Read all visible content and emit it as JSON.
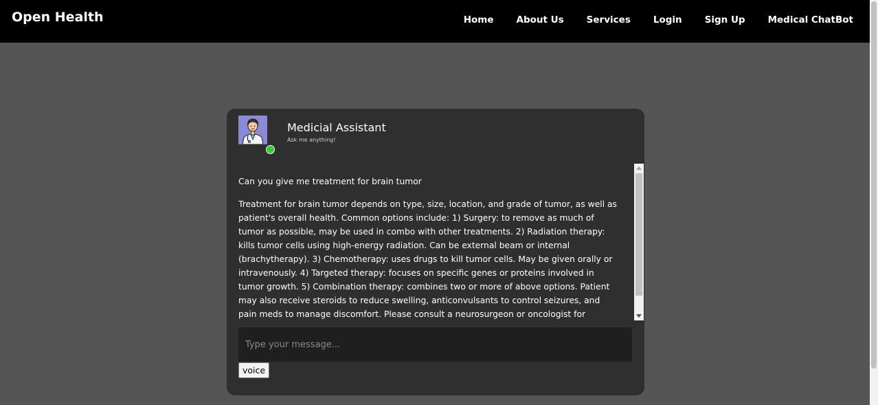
{
  "navbar": {
    "brand": "Open Health",
    "links": [
      {
        "label": "Home"
      },
      {
        "label": "About Us"
      },
      {
        "label": "Services"
      },
      {
        "label": "Login"
      },
      {
        "label": "Sign Up"
      },
      {
        "label": "Medical ChatBot"
      }
    ]
  },
  "chat": {
    "title": "Medicial Assistant",
    "subtitle": "Ask me anything!",
    "status_color": "#3ec43e",
    "messages": [
      {
        "role": "user",
        "text": "Can you give me treatment for brain tumor"
      },
      {
        "role": "assistant",
        "text": "Treatment for brain tumor depends on type, size, location, and grade of tumor, as well as patient's overall health. Common options include: 1) Surgery: to remove as much of tumor as possible, may be used in combo with other treatments. 2) Radiation therapy: kills tumor cells using high-energy radiation. Can be external beam or internal (brachytherapy). 3) Chemotherapy: uses drugs to kill tumor cells. May be given orally or intravenously. 4) Targeted therapy: focuses on specific genes or proteins involved in tumor growth. 5) Combination therapy: combines two or more of above options. Patient may also receive steroids to reduce swelling, anticonvulsants to control seizures, and pain meds to manage discomfort. Please consult a neurosurgeon or oncologist for personalized treatment plan."
      }
    ],
    "input": {
      "placeholder": "Type your message...",
      "value": ""
    },
    "voice_label": "voice"
  },
  "icons": {
    "avatar": "doctor-avatar-icon"
  }
}
